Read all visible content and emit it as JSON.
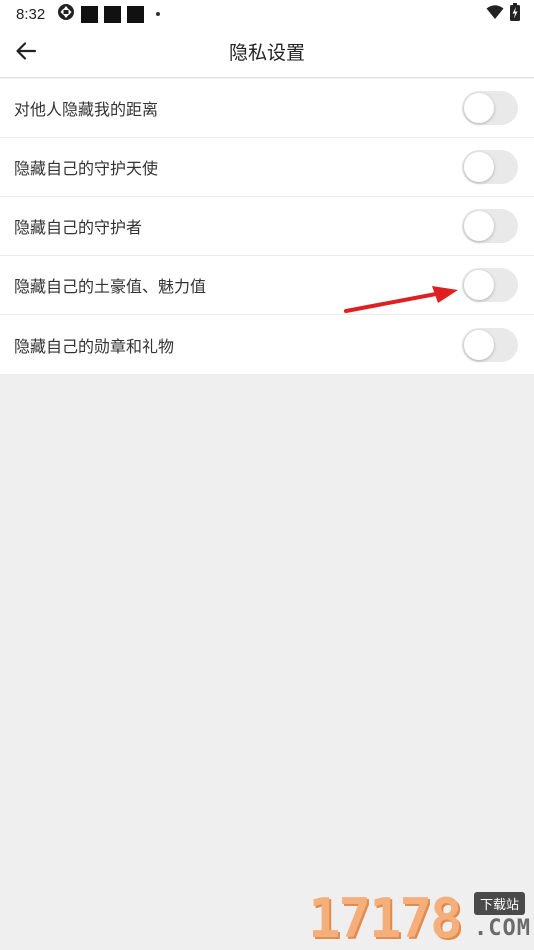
{
  "status_bar": {
    "time": "8:32",
    "icons": [
      "aperture-icon",
      "notification-square-icon",
      "notification-square-icon",
      "notification-square-icon",
      "dot-icon",
      "wifi-icon",
      "battery-charging-icon"
    ]
  },
  "header": {
    "title": "隐私设置",
    "back_icon": "arrow-left-icon"
  },
  "settings": [
    {
      "label": "对他人隐藏我的距离",
      "enabled": false
    },
    {
      "label": "隐藏自己的守护天使",
      "enabled": false
    },
    {
      "label": "隐藏自己的守护者",
      "enabled": false
    },
    {
      "label": "隐藏自己的土豪值、魅力值",
      "enabled": false
    },
    {
      "label": "隐藏自己的勋章和礼物",
      "enabled": false
    }
  ],
  "annotation": {
    "color": "#e02020",
    "target": "settings.3"
  },
  "watermark": {
    "number": "17178",
    "tag": "下载站",
    "suffix": ".COM"
  },
  "colors": {
    "background": "#efefef",
    "surface": "#ffffff",
    "toggle_off": "#e9e9e9",
    "text": "#333333"
  }
}
